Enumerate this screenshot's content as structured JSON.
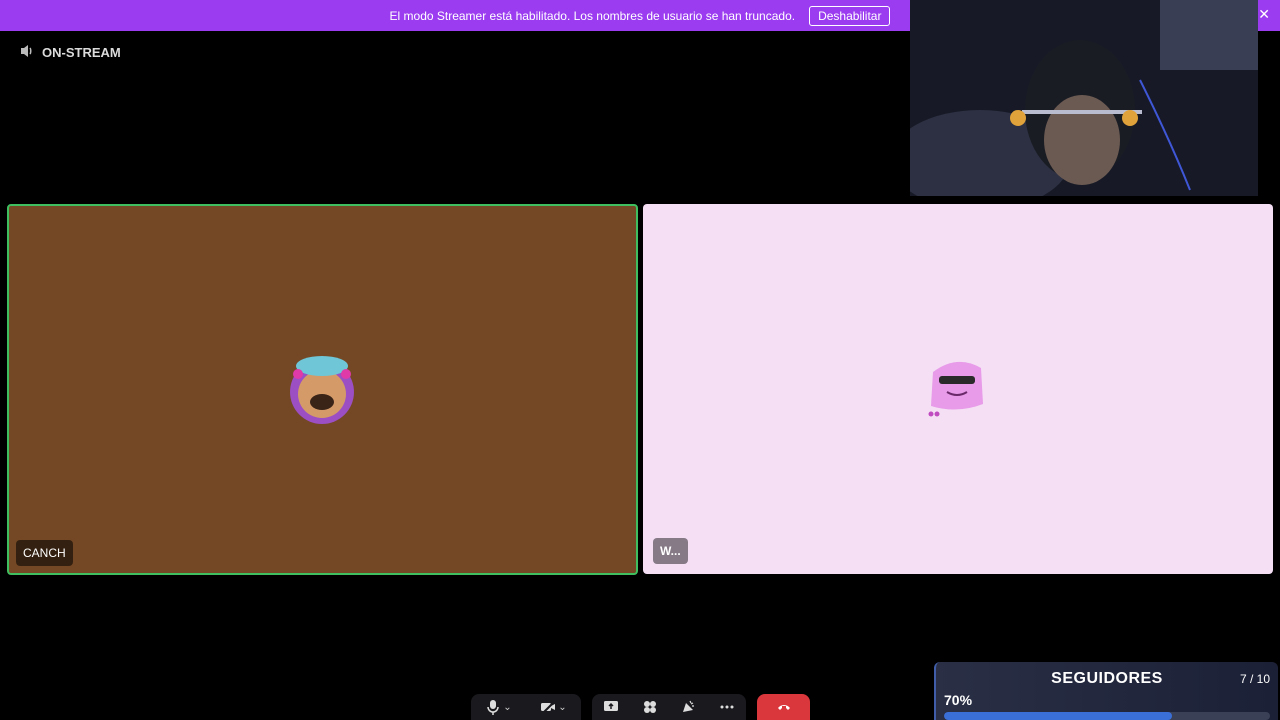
{
  "banner": {
    "message": "El modo Streamer está habilitado. Los nombres de usuario se han truncado.",
    "button_label": "Deshabilitar",
    "close_glyph": "✕"
  },
  "status": {
    "label": "ON-STREAM",
    "icon": "broadcast-icon"
  },
  "participants": [
    {
      "name": "CANCH",
      "speaking": true,
      "tile_color": "#744824"
    },
    {
      "name": "W...",
      "speaking": false,
      "tile_color": "#f5dff5"
    }
  ],
  "controls": {
    "icons": [
      "microphone-icon",
      "camera-off-icon",
      "screen-share-icon",
      "activities-icon",
      "soundboard-icon",
      "more-icon",
      "hang-up-icon"
    ],
    "hangup_color": "#da373c"
  },
  "goal": {
    "title": "SEGUIDORES",
    "count": "7 / 10",
    "percent_label": "70%",
    "progress": 0.7
  },
  "colors": {
    "banner": "#9b3cf0",
    "speaking_border": "#3fbf5f",
    "goal_fill": "#3b6fd8"
  }
}
